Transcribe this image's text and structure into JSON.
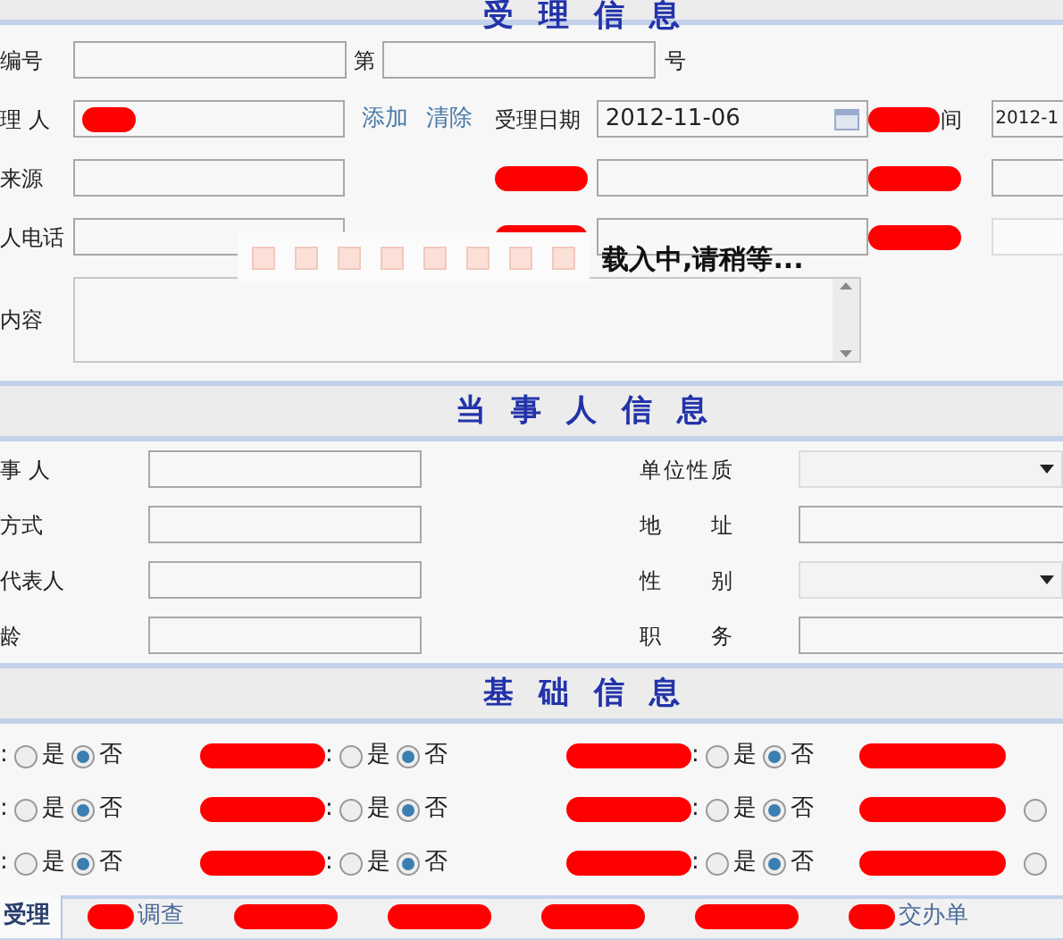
{
  "acceptance": {
    "title": "受 理 信 息",
    "number_row": {
      "label": "编号",
      "prefix": "第",
      "suffix": "号"
    },
    "rows": [
      [
        {
          "kind": "label",
          "text": "理 人"
        },
        {
          "kind": "input",
          "redacted": true
        },
        {
          "kind": "links",
          "links": [
            "添加",
            "清除"
          ]
        },
        {
          "kind": "label",
          "text": "受理日期"
        },
        {
          "kind": "date",
          "value": "2012-11-06"
        },
        {
          "kind": "label",
          "text": "间",
          "redacted": true
        },
        {
          "kind": "input",
          "value": "2012-1"
        }
      ],
      [
        {
          "kind": "label",
          "text": "来源"
        },
        {
          "kind": "input"
        },
        {
          "kind": "label",
          "redacted": true
        },
        {
          "kind": "input"
        },
        {
          "kind": "label",
          "redacted": true
        },
        {
          "kind": "input"
        }
      ],
      [
        {
          "kind": "label",
          "text": "人电话"
        },
        {
          "kind": "input"
        },
        {
          "kind": "label",
          "redacted": true
        },
        {
          "kind": "input"
        },
        {
          "kind": "label",
          "redacted": true
        },
        {
          "kind": "input",
          "disabled": true
        }
      ]
    ],
    "content_label": "内容"
  },
  "loading": {
    "text": "载入中,请稍等..."
  },
  "parties": {
    "title": "当 事 人 信 息",
    "rows": [
      {
        "left": "事 人",
        "right": {
          "label": "单位性质",
          "kind": "select"
        }
      },
      {
        "left": "方式",
        "right": {
          "label": "地 址",
          "kind": "input"
        }
      },
      {
        "left": "代表人",
        "right": {
          "label": "性 别",
          "kind": "select"
        }
      },
      {
        "left": "龄",
        "right": {
          "label": "职 务",
          "kind": "input"
        }
      }
    ]
  },
  "basics": {
    "title": "基 础 信 息",
    "rows": [
      [
        {
          "label": ":",
          "options": [
            {
              "label": "是",
              "selected": false
            },
            {
              "label": "否",
              "selected": true
            }
          ]
        },
        {
          "redacted": true,
          "label": ":",
          "options": [
            {
              "label": "是",
              "selected": false
            },
            {
              "label": "否",
              "selected": true
            }
          ]
        },
        {
          "redacted": true,
          "label": ":",
          "options": [
            {
              "label": "是",
              "selected": false
            },
            {
              "label": "否",
              "selected": true
            }
          ]
        },
        {
          "redacted": true
        }
      ],
      [
        {
          "label": ":",
          "options": [
            {
              "label": "是",
              "selected": false
            },
            {
              "label": "否",
              "selected": true
            }
          ]
        },
        {
          "redacted": true,
          "label": ":",
          "options": [
            {
              "label": "是",
              "selected": false
            },
            {
              "label": "否",
              "selected": true
            }
          ]
        },
        {
          "redacted": true,
          "label": ":",
          "options": [
            {
              "label": "是",
              "selected": false
            },
            {
              "label": "否",
              "selected": true
            }
          ]
        },
        {
          "redacted": true,
          "options": [
            {
              "selected": false
            }
          ]
        }
      ],
      [
        {
          "label": ":",
          "options": [
            {
              "label": "是",
              "selected": false
            },
            {
              "label": "否",
              "selected": true
            }
          ]
        },
        {
          "redacted": true,
          "label": ":",
          "options": [
            {
              "label": "是",
              "selected": false
            },
            {
              "label": "否",
              "selected": true
            }
          ]
        },
        {
          "redacted": true,
          "label": ":",
          "options": [
            {
              "label": "是",
              "selected": false
            },
            {
              "label": "否",
              "selected": true
            }
          ]
        },
        {
          "redacted": true,
          "options": [
            {
              "selected": false
            }
          ]
        }
      ]
    ]
  },
  "tabs": [
    {
      "label": "受理",
      "selected": true
    },
    {
      "label": "调查",
      "redacted": true,
      "selected": false
    },
    {
      "redacted": true,
      "selected": false
    },
    {
      "redacted": true,
      "selected": false
    },
    {
      "redacted": true,
      "selected": false
    },
    {
      "redacted": true,
      "selected": false
    },
    {
      "label": "交办单",
      "redacted": true,
      "selected": false
    }
  ]
}
